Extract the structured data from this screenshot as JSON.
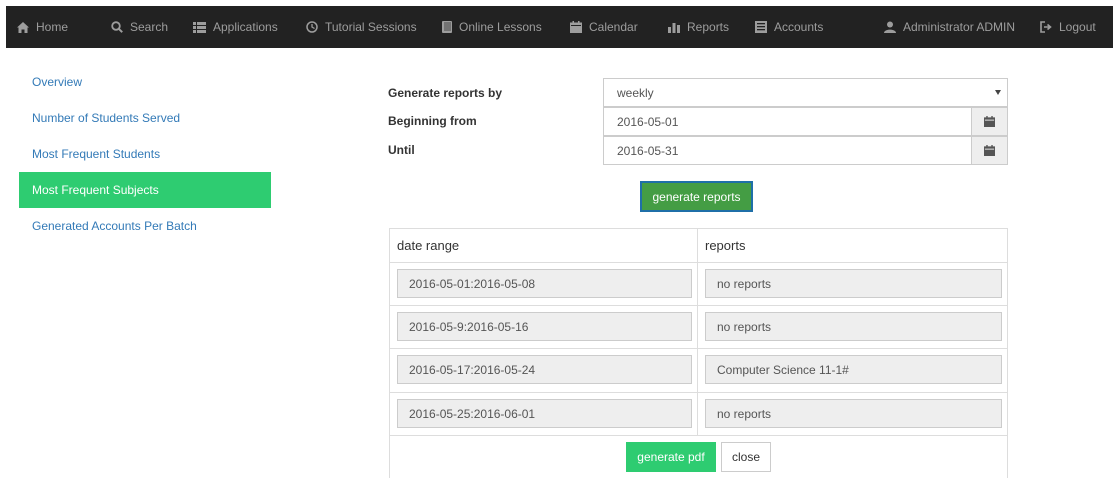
{
  "nav": {
    "home": "Home",
    "search": "Search",
    "applications": "Applications",
    "tutorial_sessions": "Tutorial Sessions",
    "online_lessons": "Online Lessons",
    "calendar": "Calendar",
    "reports": "Reports",
    "accounts": "Accounts",
    "user": "Administrator ADMIN",
    "logout": "Logout"
  },
  "sidebar": {
    "items": [
      {
        "label": "Overview"
      },
      {
        "label": "Number of Students Served"
      },
      {
        "label": "Most Frequent Students"
      },
      {
        "label": "Most Frequent Subjects",
        "active": true
      },
      {
        "label": "Generated Accounts Per Batch"
      }
    ]
  },
  "form": {
    "generate_by_label": "Generate reports by",
    "generate_by_value": "weekly",
    "beginning_label": "Beginning from",
    "beginning_value": "2016-05-01",
    "until_label": "Until",
    "until_value": "2016-05-31",
    "generate_button": "generate reports"
  },
  "table": {
    "headers": {
      "date_range": "date range",
      "reports": "reports"
    },
    "rows": [
      {
        "date_range": "2016-05-01:2016-05-08",
        "reports": "no reports"
      },
      {
        "date_range": "2016-05-9:2016-05-16",
        "reports": "no reports"
      },
      {
        "date_range": "2016-05-17:2016-05-24",
        "reports": "Computer Science 11-1#"
      },
      {
        "date_range": "2016-05-25:2016-06-01",
        "reports": "no reports"
      }
    ],
    "generate_pdf_button": "generate pdf",
    "close_button": "close"
  },
  "colors": {
    "navbar": "#222222",
    "accent_green": "#2ecc71",
    "button_green": "#449d44",
    "link_blue": "#337ab7"
  },
  "icons": [
    "home-icon",
    "search-icon",
    "list-icon",
    "clock-icon",
    "book-icon",
    "calendar-icon",
    "bar-chart-icon",
    "grid-icon",
    "user-icon",
    "logout-icon",
    "calendar-icon",
    "chevron-down-icon"
  ]
}
